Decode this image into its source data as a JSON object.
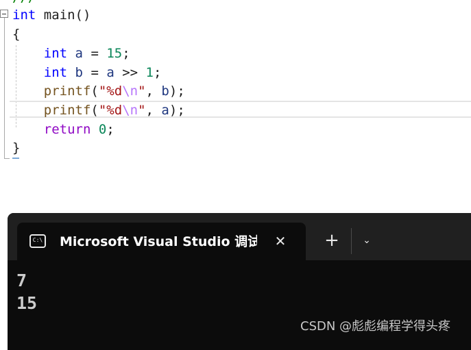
{
  "editor": {
    "top_fragment": "///",
    "lines": [
      {
        "tokens": [
          {
            "text": "int",
            "cls": "kw"
          },
          {
            "text": " main()",
            "cls": "plain"
          }
        ]
      },
      {
        "tokens": [
          {
            "text": "{",
            "cls": "plain"
          }
        ]
      },
      {
        "tokens": [
          {
            "text": "    ",
            "cls": "plain"
          },
          {
            "text": "int",
            "cls": "kw"
          },
          {
            "text": " ",
            "cls": "plain"
          },
          {
            "text": "a",
            "cls": "ident"
          },
          {
            "text": " = ",
            "cls": "plain"
          },
          {
            "text": "15",
            "cls": "num"
          },
          {
            "text": ";",
            "cls": "plain"
          }
        ]
      },
      {
        "tokens": [
          {
            "text": "    ",
            "cls": "plain"
          },
          {
            "text": "int",
            "cls": "kw"
          },
          {
            "text": " ",
            "cls": "plain"
          },
          {
            "text": "b",
            "cls": "ident"
          },
          {
            "text": " = ",
            "cls": "plain"
          },
          {
            "text": "a",
            "cls": "ident"
          },
          {
            "text": " >> ",
            "cls": "plain"
          },
          {
            "text": "1",
            "cls": "num"
          },
          {
            "text": ";",
            "cls": "plain"
          }
        ]
      },
      {
        "tokens": [
          {
            "text": "    ",
            "cls": "plain"
          },
          {
            "text": "printf",
            "cls": "fn"
          },
          {
            "text": "(",
            "cls": "plain"
          },
          {
            "text": "\"%d",
            "cls": "str"
          },
          {
            "text": "\\n",
            "cls": "esc"
          },
          {
            "text": "\"",
            "cls": "str"
          },
          {
            "text": ", ",
            "cls": "plain"
          },
          {
            "text": "b",
            "cls": "ident"
          },
          {
            "text": ");",
            "cls": "plain"
          }
        ]
      },
      {
        "tokens": [
          {
            "text": "    ",
            "cls": "plain"
          },
          {
            "text": "printf",
            "cls": "fn"
          },
          {
            "text": "(",
            "cls": "plain"
          },
          {
            "text": "\"%d",
            "cls": "str"
          },
          {
            "text": "\\n",
            "cls": "esc"
          },
          {
            "text": "\"",
            "cls": "str"
          },
          {
            "text": ", ",
            "cls": "plain"
          },
          {
            "text": "a",
            "cls": "ident"
          },
          {
            "text": ");",
            "cls": "plain"
          }
        ]
      },
      {
        "tokens": [
          {
            "text": "    ",
            "cls": "plain"
          },
          {
            "text": "return",
            "cls": "ctrl"
          },
          {
            "text": " ",
            "cls": "plain"
          },
          {
            "text": "0",
            "cls": "num"
          },
          {
            "text": ";",
            "cls": "plain"
          }
        ]
      },
      {
        "tokens": [
          {
            "text": "}",
            "cls": "plain"
          }
        ]
      }
    ]
  },
  "terminal": {
    "tab_icon_text": "C:\\",
    "tab_title": "Microsoft Visual Studio 调试控制台",
    "close_glyph": "✕",
    "new_tab_glyph": "+",
    "dropdown_glyph": "⌄",
    "output_lines": [
      "7",
      "15"
    ],
    "colors": {
      "background": "#0c0c0c",
      "tab_strip": "#202020",
      "text": "#cccccc"
    }
  },
  "watermark": "CSDN @彪彪编程学得头疼"
}
